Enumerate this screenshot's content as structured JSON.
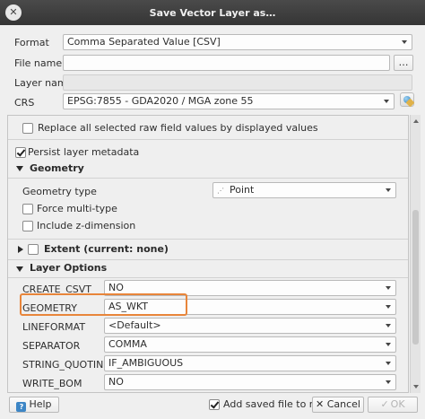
{
  "window": {
    "title": "Save Vector Layer as…"
  },
  "form": {
    "format_label": "Format",
    "format_value": "Comma Separated Value [CSV]",
    "filename_label": "File name",
    "filename_value": "",
    "browse_label": "…",
    "layername_label": "Layer name",
    "layername_value": "",
    "crs_label": "CRS",
    "crs_value": "EPSG:7855 - GDA2020 / MGA zone 55"
  },
  "options": {
    "replace_raw_label": "Replace all selected raw field values by displayed values",
    "replace_raw_checked": false,
    "persist_label": "Persist layer metadata",
    "persist_checked": true
  },
  "geometry": {
    "section_title": "Geometry",
    "type_label": "Geometry type",
    "type_value": "Point",
    "force_multi_label": "Force multi-type",
    "force_multi_checked": false,
    "z_dim_label": "Include z-dimension",
    "z_dim_checked": false
  },
  "extent": {
    "section_title": "Extent (current: none)",
    "checked": false
  },
  "layer_options": {
    "section_title": "Layer Options",
    "rows": [
      {
        "key": "CREATE_CSVT",
        "value": "NO"
      },
      {
        "key": "GEOMETRY",
        "value": "AS_WKT"
      },
      {
        "key": "LINEFORMAT",
        "value": "<Default>"
      },
      {
        "key": "SEPARATOR",
        "value": "COMMA"
      },
      {
        "key": "STRING_QUOTING",
        "value": "IF_AMBIGUOUS"
      },
      {
        "key": "WRITE_BOM",
        "value": "NO"
      }
    ]
  },
  "footer": {
    "help_label": "Help",
    "add_to_map_label": "Add saved file to map",
    "add_to_map_checked": true,
    "cancel_label": "Cancel",
    "ok_label": "OK"
  },
  "colors": {
    "highlight": "#e8853a",
    "titlebar": "#3d3d3d"
  }
}
